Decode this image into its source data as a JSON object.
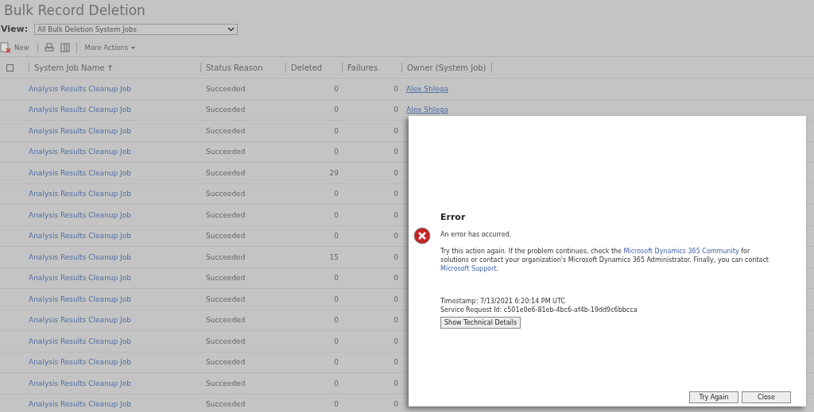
{
  "page": {
    "title": "Bulk Record Deletion",
    "view_label": "View:",
    "view_value": "All Bulk Deletion System Jobs"
  },
  "toolbar": [
    {
      "kind": "new",
      "label": "New"
    },
    {
      "kind": "print"
    },
    {
      "kind": "columns"
    },
    {
      "kind": "menu",
      "label": "More Actions"
    }
  ],
  "table": {
    "select_all": {
      "checked": false
    },
    "columns": [
      {
        "label": "System Job Name",
        "sorted": true
      },
      {
        "label": "Status Reason",
        "sorted": false
      },
      {
        "label": "Deleted",
        "sorted": false
      },
      {
        "label": "Failures",
        "sorted": false
      },
      {
        "label": "Owner (System Job)",
        "sorted": false
      }
    ],
    "rows": [
      {
        "name": "Analysis Results Cleanup Job",
        "status": "Succeeded",
        "deleted": "0",
        "failures": "0",
        "owner": "Alex Shlega"
      },
      {
        "name": "Analysis Results Cleanup Job",
        "status": "Succeeded",
        "deleted": "0",
        "failures": "0",
        "owner": "Alex Shlega"
      },
      {
        "name": "Analysis Results Cleanup Job",
        "status": "Succeeded",
        "deleted": "0",
        "failures": "0"
      },
      {
        "name": "Analysis Results Cleanup Job",
        "status": "Succeeded",
        "deleted": "0",
        "failures": "0"
      },
      {
        "name": "Analysis Results Cleanup Job",
        "status": "Succeeded",
        "deleted": "29",
        "failures": "0"
      },
      {
        "name": "Analysis Results Cleanup Job",
        "status": "Succeeded",
        "deleted": "0",
        "failures": "0"
      },
      {
        "name": "Analysis Results Cleanup Job",
        "status": "Succeeded",
        "deleted": "0",
        "failures": "0"
      },
      {
        "name": "Analysis Results Cleanup Job",
        "status": "Succeeded",
        "deleted": "0",
        "failures": "0"
      },
      {
        "name": "Analysis Results Cleanup Job",
        "status": "Succeeded",
        "deleted": "15",
        "failures": "0"
      },
      {
        "name": "Analysis Results Cleanup Job",
        "status": "Succeeded",
        "deleted": "0",
        "failures": "0"
      },
      {
        "name": "Analysis Results Cleanup Job",
        "status": "Succeeded",
        "deleted": "0",
        "failures": "0"
      },
      {
        "name": "Analysis Results Cleanup Job",
        "status": "Succeeded",
        "deleted": "0",
        "failures": "0"
      },
      {
        "name": "Analysis Results Cleanup Job",
        "status": "Succeeded",
        "deleted": "0",
        "failures": "0"
      },
      {
        "name": "Analysis Results Cleanup Job",
        "status": "Succeeded",
        "deleted": "0",
        "failures": "0"
      },
      {
        "name": "Analysis Results Cleanup Job",
        "status": "Succeeded",
        "deleted": "0",
        "failures": "0"
      },
      {
        "name": "Analysis Results Cleanup Job",
        "status": "Succeeded",
        "deleted": "0",
        "failures": "0"
      }
    ]
  },
  "dialog": {
    "title": "Error",
    "message": "An error has occurred.",
    "details": {
      "text_1": "Try this action again. If the problem continues, check the ",
      "link_1": "Microsoft Dynamics 365 Community",
      "text_2": " for solutions or contact your organization's Microsoft Dynamics 365 Administrator. Finally, you can contact ",
      "link_2": "Microsoft Support",
      "text_3": "."
    },
    "timestamp": "Timestamp: 7/13/2021 6:20:14 PM UTC",
    "request_id": "Service Request Id: c501e0e6-81eb-4bc6-af4b-19dd9c6bbcca",
    "details_button": "Show Technical Details",
    "buttons": [
      "Try Again",
      "Close"
    ]
  }
}
